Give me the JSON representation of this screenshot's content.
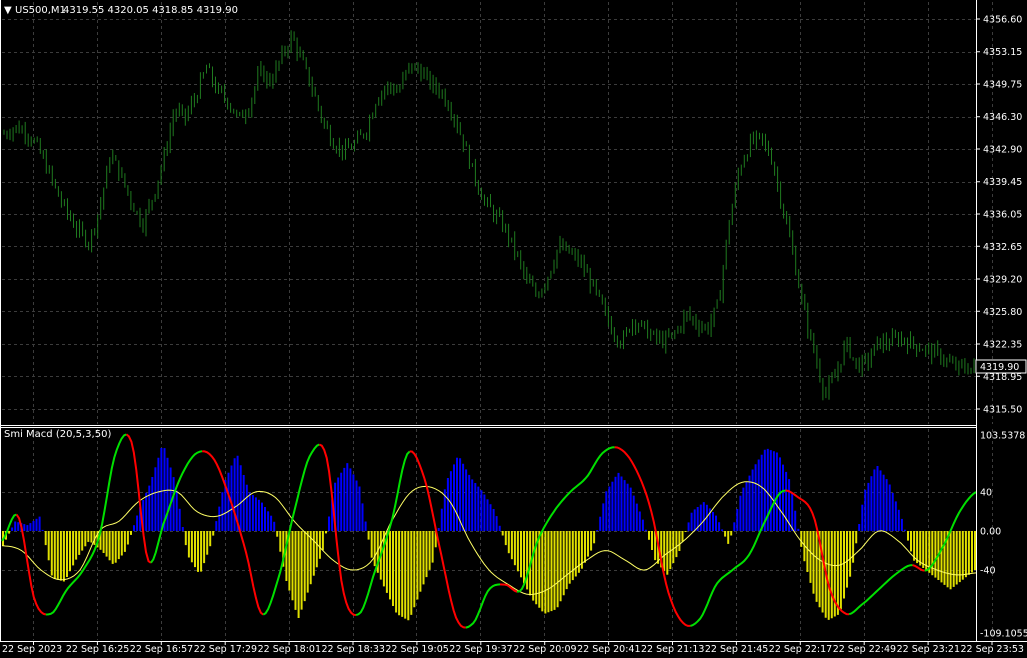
{
  "header": {
    "symbol": "US500,M1",
    "ohlc": "4319.55 4320.05 4318.85 4319.90"
  },
  "indicator": {
    "title": "Smi Macd (20,5,3,50)"
  },
  "colors": {
    "background": "#000000",
    "grid": "#3c3c3c",
    "candles": "#1f7a1f",
    "histogram_up": "#0000ff",
    "histogram_down": "#e0e000",
    "fast_line_up": "#00e000",
    "fast_line_down": "#ff0000",
    "signal_line": "#ffff66",
    "text": "#ffffff"
  },
  "chart_data": [
    {
      "type": "line",
      "title": "US500,M1",
      "series_name": "US500 M1 candles",
      "y_ticks": [
        "4356.60",
        "4353.15",
        "4349.75",
        "4346.30",
        "4342.90",
        "4339.45",
        "4336.05",
        "4332.65",
        "4329.20",
        "4325.80",
        "4322.35",
        "4318.95",
        "4315.50"
      ],
      "ylim": [
        4313.8,
        4358.4
      ],
      "current_price": "4319.90",
      "x_ticks": [
        "22 Sep 2023",
        "22 Sep 16:25",
        "22 Sep 16:57",
        "22 Sep 17:29",
        "22 Sep 18:01",
        "22 Sep 18:33",
        "22 Sep 19:05",
        "22 Sep 19:37",
        "22 Sep 20:09",
        "22 Sep 20:41",
        "22 Sep 21:13",
        "22 Sep 21:45",
        "22 Sep 22:17",
        "22 Sep 22:49",
        "22 Sep 23:21",
        "22 Sep 23:53"
      ],
      "close_path": [
        4344.5,
        4345.2,
        4344.8,
        4343.4,
        4341.0,
        4338.2,
        4336.0,
        4334.2,
        4333.1,
        4336.8,
        4342.4,
        4340.0,
        4337.2,
        4335.0,
        4338.0,
        4342.0,
        4347.0,
        4346.2,
        4348.5,
        4351.5,
        4349.0,
        4348.0,
        4346.0,
        4347.5,
        4351.0,
        4350.0,
        4352.5,
        4354.8,
        4352.0,
        4349.0,
        4345.5,
        4343.5,
        4342.6,
        4343.5,
        4345.0,
        4348.5,
        4349.5,
        4349.0,
        4351.6,
        4351.2,
        4349.8,
        4349.0,
        4347.0,
        4344.0,
        4340.5,
        4337.5,
        4336.0,
        4334.5,
        4332.0,
        4329.0,
        4327.5,
        4329.5,
        4332.6,
        4332.0,
        4331.0,
        4329.0,
        4326.5,
        4324.0,
        4322.5,
        4325.0,
        4324.0,
        4323.0,
        4322.6,
        4323.5,
        4325.5,
        4324.5,
        4324.0,
        4326.5,
        4335.0,
        4341.0,
        4343.5,
        4344.0,
        4342.0,
        4337.0,
        4332.0,
        4326.0,
        4321.5,
        4317.0,
        4319.0,
        4322.5,
        4320.0,
        4320.5,
        4322.5,
        4322.5,
        4323.0,
        4322.5,
        4322.0,
        4321.5,
        4321.0,
        4320.0,
        4319.8,
        4319.9
      ]
    },
    {
      "type": "bar",
      "title": "Smi Macd (20,5,3,50)",
      "y_ticks": [
        "103.5378",
        "40",
        "0.00",
        "-40",
        "-109.1055"
      ],
      "ylim": [
        -109.1055,
        103.5378
      ],
      "histogram": [
        -15,
        10,
        6,
        15,
        -48,
        -52,
        -28,
        -10,
        -20,
        -35,
        -20,
        20,
        50,
        90,
        50,
        -25,
        -45,
        -10,
        50,
        80,
        40,
        30,
        12,
        -50,
        -90,
        -55,
        -20,
        50,
        70,
        45,
        -30,
        -58,
        -85,
        -92,
        -60,
        -30,
        50,
        78,
        55,
        40,
        20,
        -20,
        -45,
        -70,
        -85,
        -80,
        -55,
        -40,
        -15,
        40,
        60,
        45,
        12,
        -30,
        -45,
        -20,
        20,
        30,
        15,
        -15,
        40,
        65,
        85,
        80,
        50,
        -25,
        -70,
        -92,
        -85,
        -40,
        40,
        68,
        50,
        15,
        -30,
        -40,
        -50,
        -60,
        -50,
        -40
      ],
      "fast_line": [
        -10,
        15,
        -70,
        -85,
        -60,
        -40,
        -5,
        80,
        90,
        -30,
        10,
        55,
        80,
        75,
        35,
        -20,
        -85,
        -50,
        20,
        78,
        75,
        -60,
        -85,
        -40,
        10,
        80,
        55,
        -20,
        -90,
        -95,
        -60,
        -55,
        -60,
        -10,
        20,
        40,
        55,
        80,
        85,
        65,
        20,
        -60,
        -95,
        -90,
        -55,
        -40,
        -25,
        10,
        40,
        35,
        15,
        -60,
        -85,
        -75,
        -60,
        -45,
        -35,
        -40,
        -15,
        20,
        40
      ],
      "signal_line": [
        -15,
        -20,
        -40,
        -50,
        -40,
        0,
        10,
        30,
        40,
        40,
        20,
        15,
        25,
        40,
        35,
        10,
        -10,
        -30,
        -40,
        -30,
        10,
        40,
        45,
        30,
        -10,
        -40,
        -55,
        -65,
        -60,
        -45,
        -30,
        -20,
        -30,
        -40,
        -25,
        -10,
        10,
        35,
        50,
        45,
        20,
        -10,
        -30,
        -35,
        -20,
        0,
        -10,
        -30,
        -40,
        -45,
        -43
      ]
    }
  ]
}
